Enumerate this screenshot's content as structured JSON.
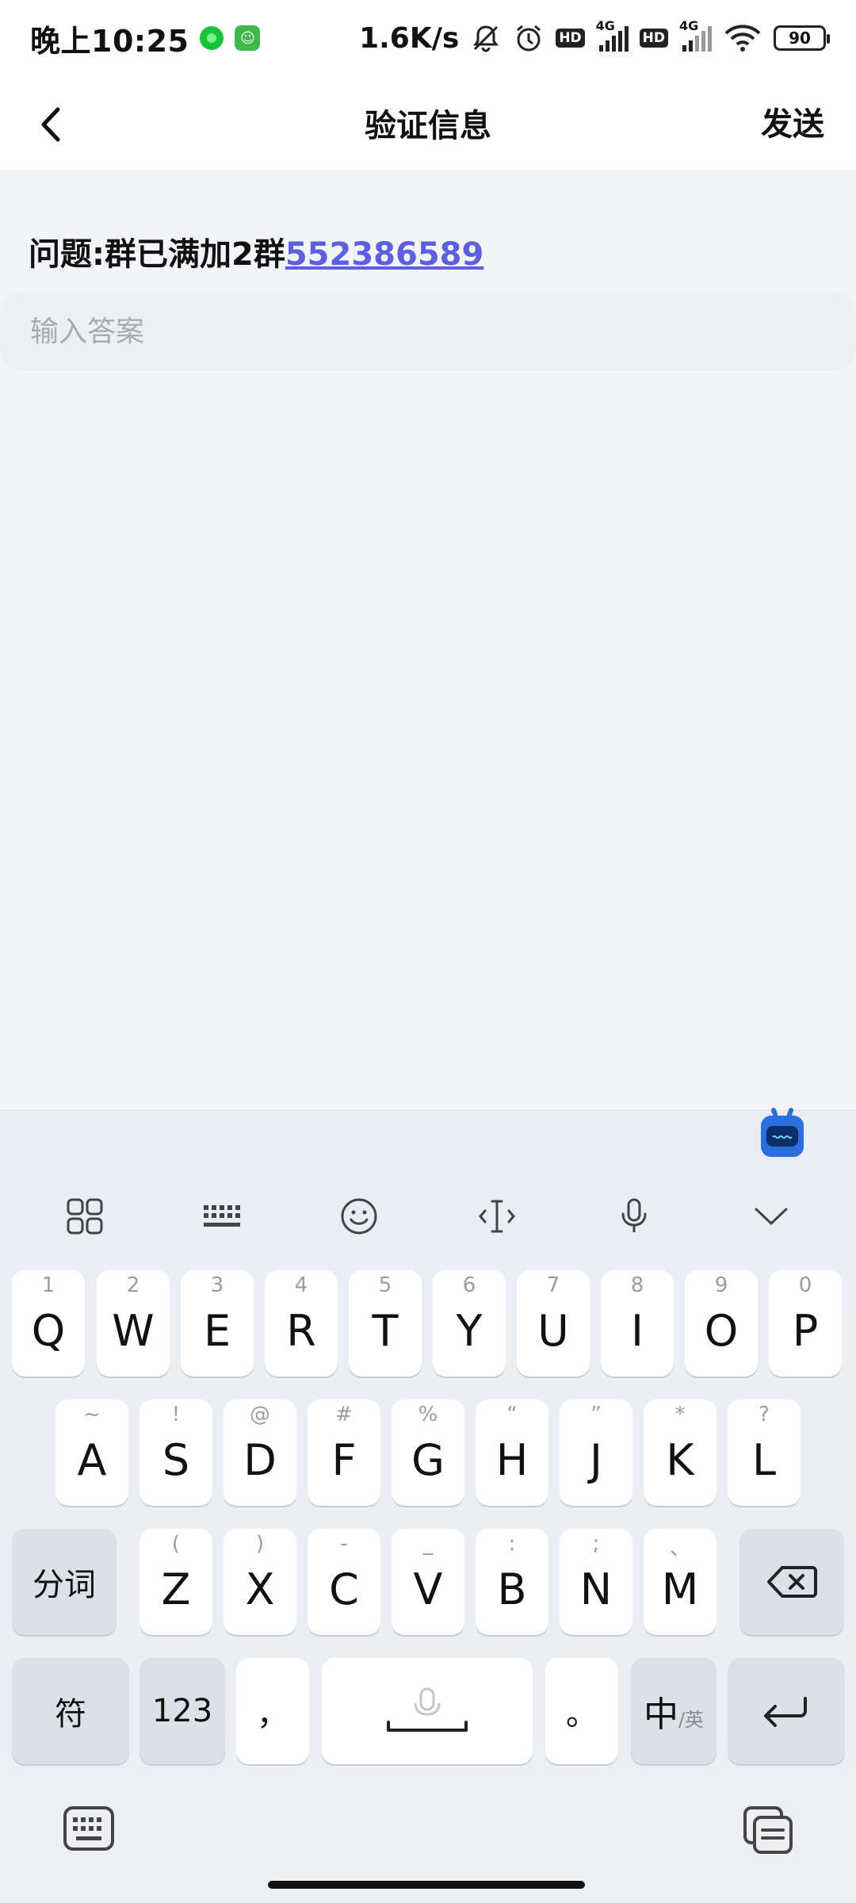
{
  "status_bar": {
    "time": "晚上10:25",
    "net_speed": "1.6K/s",
    "hd1": "HD",
    "hd2": "HD",
    "net1": "4G",
    "net2": "4G",
    "battery": "90"
  },
  "header": {
    "title": "验证信息",
    "send_label": "发送"
  },
  "question": {
    "prefix": "问题:群已满加2群",
    "number": "552386589"
  },
  "answer": {
    "placeholder": "输入答案",
    "value": ""
  },
  "keyboard": {
    "row1": [
      {
        "hint": "1",
        "label": "Q"
      },
      {
        "hint": "2",
        "label": "W"
      },
      {
        "hint": "3",
        "label": "E"
      },
      {
        "hint": "4",
        "label": "R"
      },
      {
        "hint": "5",
        "label": "T"
      },
      {
        "hint": "6",
        "label": "Y"
      },
      {
        "hint": "7",
        "label": "U"
      },
      {
        "hint": "8",
        "label": "I"
      },
      {
        "hint": "9",
        "label": "O"
      },
      {
        "hint": "0",
        "label": "P"
      }
    ],
    "row2": [
      {
        "hint": "~",
        "label": "A"
      },
      {
        "hint": "!",
        "label": "S"
      },
      {
        "hint": "@",
        "label": "D"
      },
      {
        "hint": "#",
        "label": "F"
      },
      {
        "hint": "%",
        "label": "G"
      },
      {
        "hint": "“",
        "label": "H"
      },
      {
        "hint": "”",
        "label": "J"
      },
      {
        "hint": "*",
        "label": "K"
      },
      {
        "hint": "?",
        "label": "L"
      }
    ],
    "row3": [
      {
        "hint": "(",
        "label": "Z"
      },
      {
        "hint": ")",
        "label": "X"
      },
      {
        "hint": "-",
        "label": "C"
      },
      {
        "hint": "_",
        "label": "V"
      },
      {
        "hint": ":",
        "label": "B"
      },
      {
        "hint": ";",
        "label": "N"
      },
      {
        "hint": "、",
        "label": "M"
      }
    ],
    "segment_label": "分词",
    "symbol_label": "符",
    "num_label": "123",
    "comma_label": "，",
    "period_label": "。",
    "lang_zh": "中",
    "lang_en": "/英"
  }
}
